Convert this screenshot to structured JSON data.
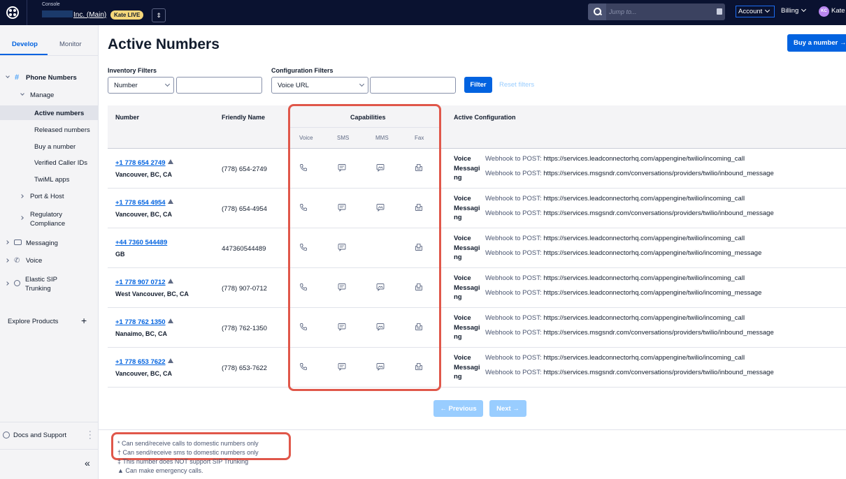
{
  "topbar": {
    "console_label": "Console",
    "account_name": "Inc. (Main)",
    "live_badge": "Kate LIVE",
    "switch_icon": "⇕",
    "search_placeholder": "Jump to...",
    "account_menu": "Account",
    "billing_menu": "Billing",
    "avatar_initials": "KC",
    "user_name": "Kate"
  },
  "sidebar": {
    "tabs": [
      "Develop",
      "Monitor"
    ],
    "phone_numbers": "Phone Numbers",
    "manage": "Manage",
    "manage_items": [
      "Active numbers",
      "Released numbers",
      "Buy a number",
      "Verified Caller IDs",
      "TwiML apps"
    ],
    "port_host": "Port & Host",
    "regulatory_1": "Regulatory",
    "regulatory_2": "Compliance",
    "messaging": "Messaging",
    "voice": "Voice",
    "elastic_1": "Elastic SIP",
    "elastic_2": "Trunking",
    "explore": "Explore Products",
    "docs": "Docs and Support",
    "collapse_icon": "«"
  },
  "main": {
    "title": "Active Numbers",
    "buy_button": "Buy a number →",
    "inventory_filters_label": "Inventory Filters",
    "inventory_select": "Number",
    "config_filters_label": "Configuration Filters",
    "config_select": "Voice URL",
    "filter_button": "Filter",
    "reset_filters": "Reset filters"
  },
  "table": {
    "headers": {
      "number": "Number",
      "friendly_name": "Friendly Name",
      "capabilities": "Capabilities",
      "active_configuration": "Active Configuration"
    },
    "capability_subheaders": [
      "Voice",
      "SMS",
      "MMS",
      "Fax"
    ],
    "rows": [
      {
        "number": "+1 778 654 2749",
        "location": "Vancouver, BC, CA",
        "friendly": "(778) 654-2749",
        "emergency": true,
        "caps": {
          "voice": true,
          "sms": true,
          "mms": true,
          "fax": true
        },
        "voice_label": "Voice",
        "messaging_label_1": "Messagi",
        "messaging_label_2": "ng",
        "voice_prefix": "Webhook to POST:",
        "voice_url": "https://services.leadconnectorhq.com/appengine/twilio/incoming_call",
        "msg_prefix": "Webhook to POST:",
        "msg_url": "https://services.msgsndr.com/conversations/providers/twilio/inbound_message"
      },
      {
        "number": "+1 778 654 4954",
        "location": "Vancouver, BC, CA",
        "friendly": "(778) 654-4954",
        "emergency": true,
        "caps": {
          "voice": true,
          "sms": true,
          "mms": true,
          "fax": true
        },
        "voice_label": "Voice",
        "messaging_label_1": "Messagi",
        "messaging_label_2": "ng",
        "voice_prefix": "Webhook to POST:",
        "voice_url": "https://services.leadconnectorhq.com/appengine/twilio/incoming_call",
        "msg_prefix": "Webhook to POST:",
        "msg_url": "https://services.msgsndr.com/conversations/providers/twilio/inbound_message"
      },
      {
        "number": "+44 7360 544489",
        "location": "GB",
        "friendly": "447360544489",
        "emergency": false,
        "caps": {
          "voice": true,
          "sms": true,
          "mms": false,
          "fax": true
        },
        "voice_label": "Voice",
        "messaging_label_1": "Messagi",
        "messaging_label_2": "ng",
        "voice_prefix": "Webhook to POST:",
        "voice_url": "https://services.leadconnectorhq.com/appengine/twilio/incoming_call",
        "msg_prefix": "Webhook to POST:",
        "msg_url": "https://services.leadconnectorhq.com/appengine/twilio/incoming_message"
      },
      {
        "number": "+1 778 907 0712",
        "location": "West Vancouver, BC, CA",
        "friendly": "(778) 907-0712",
        "emergency": true,
        "caps": {
          "voice": true,
          "sms": true,
          "mms": true,
          "fax": true
        },
        "voice_label": "Voice",
        "messaging_label_1": "Messagi",
        "messaging_label_2": "ng",
        "voice_prefix": "Webhook to POST:",
        "voice_url": "https://services.leadconnectorhq.com/appengine/twilio/incoming_call",
        "msg_prefix": "Webhook to POST:",
        "msg_url": "https://services.leadconnectorhq.com/appengine/twilio/incoming_message"
      },
      {
        "number": "+1 778 762 1350",
        "location": "Nanaimo, BC, CA",
        "friendly": "(778) 762-1350",
        "emergency": true,
        "caps": {
          "voice": true,
          "sms": true,
          "mms": true,
          "fax": true
        },
        "voice_label": "Voice",
        "messaging_label_1": "Messagi",
        "messaging_label_2": "ng",
        "voice_prefix": "Webhook to POST:",
        "voice_url": "https://services.leadconnectorhq.com/appengine/twilio/incoming_call",
        "msg_prefix": "Webhook to POST:",
        "msg_url": "https://services.msgsndr.com/conversations/providers/twilio/inbound_message"
      },
      {
        "number": "+1 778 653 7622",
        "location": "Vancouver, BC, CA",
        "friendly": "(778) 653-7622",
        "emergency": true,
        "caps": {
          "voice": true,
          "sms": true,
          "mms": true,
          "fax": true
        },
        "voice_label": "Voice",
        "messaging_label_1": "Messagi",
        "messaging_label_2": "ng",
        "voice_prefix": "Webhook to POST:",
        "voice_url": "https://services.leadconnectorhq.com/appengine/twilio/incoming_call",
        "msg_prefix": "Webhook to POST:",
        "msg_url": "https://services.msgsndr.com/conversations/providers/twilio/inbound_message"
      }
    ]
  },
  "pagination": {
    "previous": "← Previous",
    "next": "Next →"
  },
  "legend": [
    "* Can send/receive calls to domestic numbers only",
    "† Can send/receive sms to domestic numbers only",
    "‡ This number does NOT support SIP Trunking",
    "▲ Can make emergency calls."
  ],
  "colors": {
    "brand_blue": "#0263e0",
    "topbar": "#0a1230",
    "highlight": "#e0574a",
    "live_badge": "#f5d77a"
  },
  "icons": {
    "voice": "phone-icon",
    "sms": "sms-icon",
    "mms": "mms-icon",
    "fax": "fax-icon",
    "emergency": "emergency-triangle-icon"
  }
}
